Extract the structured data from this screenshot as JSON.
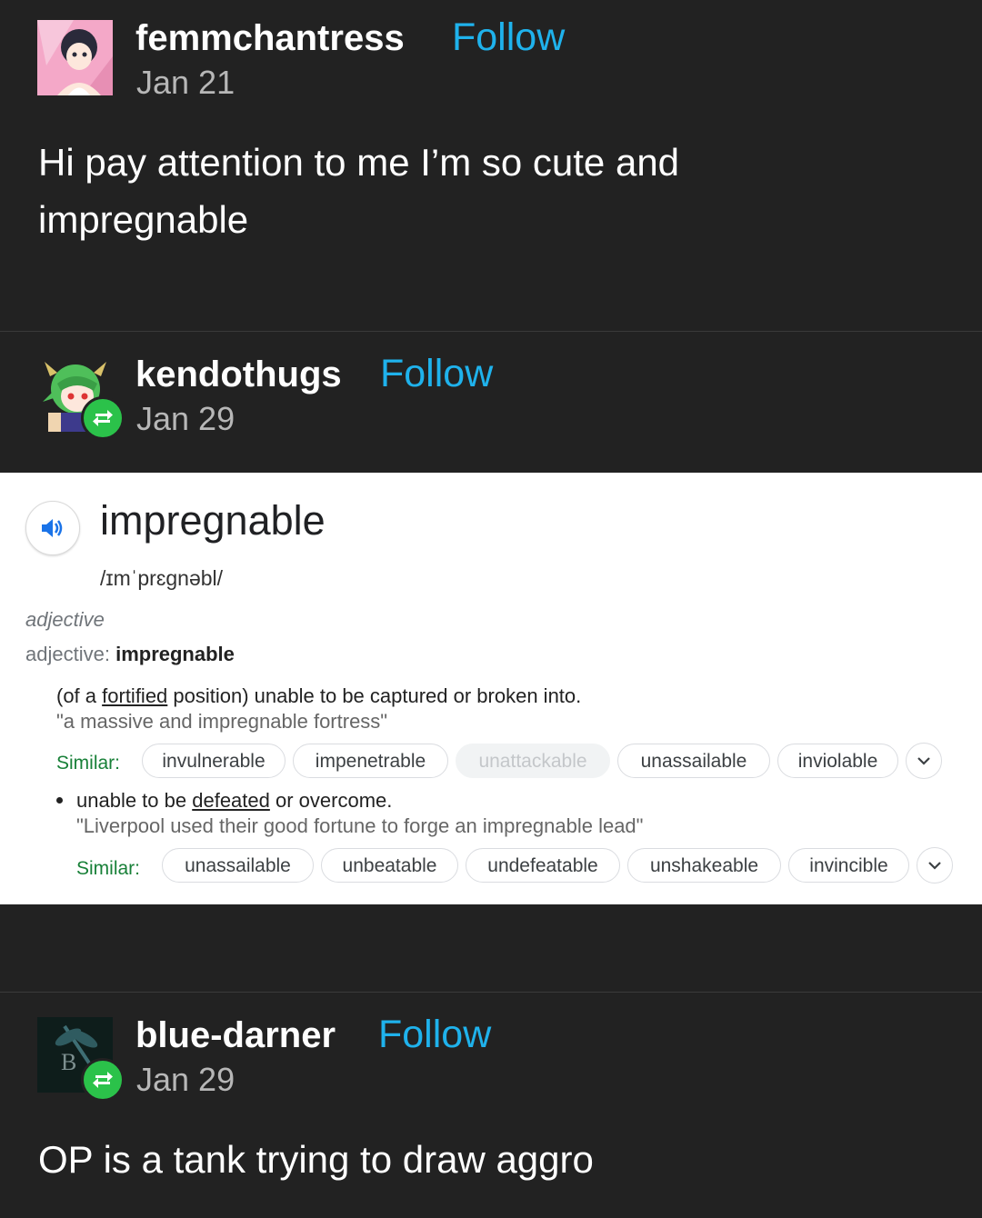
{
  "posts": [
    {
      "username": "femmchantress",
      "follow_label": "Follow",
      "date": "Jan 21",
      "body_lines": [
        "Hi pay attention to me I’m so cute and",
        "impregnable"
      ]
    },
    {
      "username": "kendothugs",
      "follow_label": "Follow",
      "date": "Jan 29",
      "reblog_icon": "reblog-icon"
    },
    {
      "username": "blue-darner",
      "follow_label": "Follow",
      "date": "Jan 29",
      "reblog_icon": "reblog-icon",
      "avatar_letter": "B",
      "body": "OP is a tank trying to draw aggro"
    }
  ],
  "dictionary": {
    "word": "impregnable",
    "phonetic": "/ɪmˈprɛɡnəbl/",
    "pos": "adjective",
    "pos_label": "adjective:",
    "pos_word": "impregnable",
    "senses": [
      {
        "definition_pre": "(of a ",
        "definition_link": "fortified",
        "definition_post": " position) unable to be captured or broken into.",
        "example": "\"a massive and impregnable fortress\"",
        "similar_label": "Similar:",
        "similar": [
          "invulnerable",
          "impenetrable",
          "unattackable",
          "unassailable",
          "inviolable"
        ]
      },
      {
        "definition_pre": "unable to be ",
        "definition_link": "defeated",
        "definition_post": " or overcome.",
        "example": "\"Liverpool used their good fortune to forge an impregnable lead\"",
        "similar_label": "Similar:",
        "similar": [
          "unassailable",
          "unbeatable",
          "undefeatable",
          "unshakeable",
          "invincible"
        ]
      }
    ]
  },
  "colors": {
    "background": "#222222",
    "follow": "#1fb2ec",
    "reblog": "#2bc24a",
    "similar_label": "#188038",
    "speaker": "#1a73e8"
  }
}
